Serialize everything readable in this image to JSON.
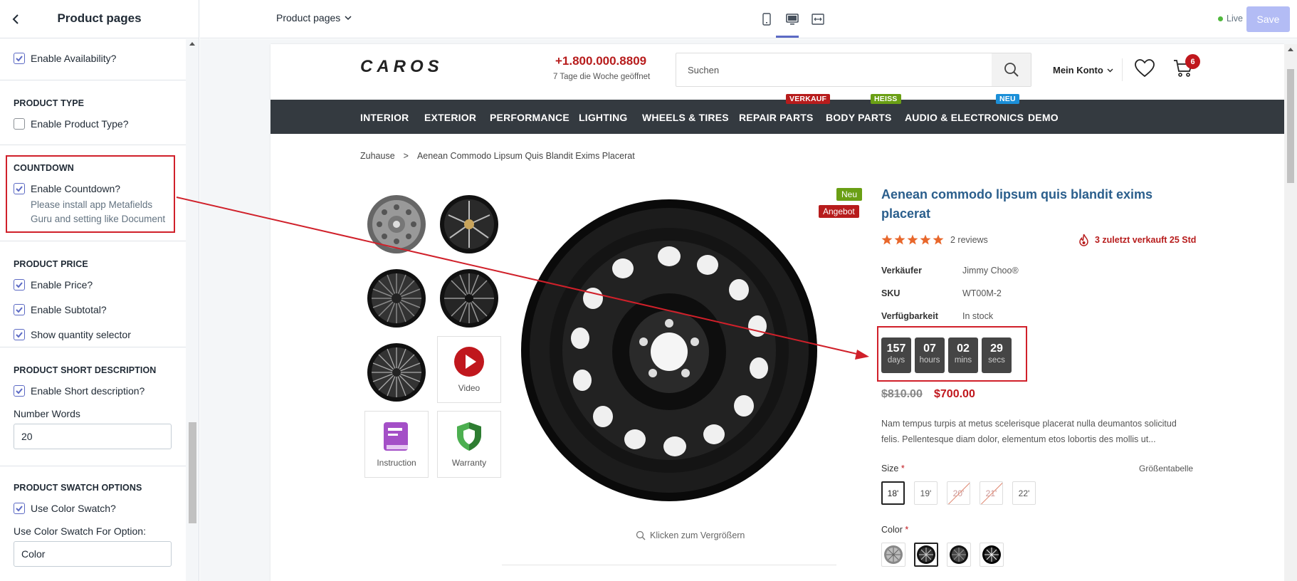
{
  "sidebar": {
    "title": "Product pages",
    "availability_label": "Enable Availability?",
    "product_type": {
      "title": "PRODUCT TYPE",
      "enable_label": "Enable Product Type?"
    },
    "countdown": {
      "title": "COUNTDOWN",
      "enable_label": "Enable Countdown?",
      "help_line1": "Please install app Metafields",
      "help_line2": "Guru and setting like Document"
    },
    "product_price": {
      "title": "PRODUCT PRICE",
      "enable_price": "Enable Price?",
      "enable_subtotal": "Enable Subtotal?",
      "show_qty": "Show quantity selector"
    },
    "short_description": {
      "title": "PRODUCT SHORT DESCRIPTION",
      "enable_label": "Enable Short description?",
      "number_words_label": "Number Words",
      "number_words_value": "20"
    },
    "swatch": {
      "title": "PRODUCT SWATCH OPTIONS",
      "use_color_swatch": "Use Color Swatch?",
      "for_option_label": "Use Color Swatch For Option:",
      "for_option_value": "Color"
    }
  },
  "topbar": {
    "page_select": "Product pages",
    "live_label": "Live",
    "save_label": "Save"
  },
  "store": {
    "logo": "CAROS",
    "phone": "+1.800.000.8809",
    "phone_sub": "7 Tage die Woche geöffnet",
    "search_placeholder": "Suchen",
    "account": "Mein Konto",
    "cart_count": "6",
    "nav": [
      {
        "label": "INTERIOR"
      },
      {
        "label": "EXTERIOR"
      },
      {
        "label": "PERFORMANCE"
      },
      {
        "label": "LIGHTING"
      },
      {
        "label": "WHEELS & TIRES"
      },
      {
        "label": "REPAIR PARTS",
        "badge": "Verkauf"
      },
      {
        "label": "BODY PARTS",
        "badge": "Heiß"
      },
      {
        "label": "AUDIO & ELECTRONICS",
        "badge": "Neu"
      },
      {
        "label": "DEMO"
      }
    ],
    "badge_colors": {
      "sale": "#b71c1c",
      "hot": "#6a9f14",
      "new": "#1b8fd8"
    }
  },
  "breadcrumb": {
    "home": "Zuhause",
    "current": "Aenean Commodo Lipsum Quis Blandit Exims Placerat"
  },
  "gallery": {
    "video_label": "Video",
    "instruction_label": "Instruction",
    "warranty_label": "Warranty",
    "badge_new": "Neu",
    "badge_sale": "Angebot",
    "zoom_label": "Klicken zum Vergrößern"
  },
  "product": {
    "title": "Aenean commodo lipsum quis blandit exims placerat",
    "rating_stars": 5,
    "reviews": "2 reviews",
    "sold": "3 zuletzt verkauft 25 Std",
    "vendor_label": "Verkäufer",
    "vendor_value": "Jimmy Choo®",
    "sku_label": "SKU",
    "sku_value": "WT00M-2",
    "availability_label": "Verfügbarkeit",
    "availability_value": "In stock",
    "countdown": [
      {
        "num": "157",
        "unit": "days"
      },
      {
        "num": "07",
        "unit": "hours"
      },
      {
        "num": "02",
        "unit": "mins"
      },
      {
        "num": "29",
        "unit": "secs"
      }
    ],
    "price_old": "$810.00",
    "price_new": "$700.00",
    "description": "Nam tempus turpis at metus scelerisque placerat nulla deumantos solicitud felis. Pellentesque diam dolor, elementum etos lobortis des mollis ut...",
    "size_label": "Size",
    "size_chart": "Größentabelle",
    "sizes": [
      "18'",
      "19'",
      "20'",
      "21'",
      "22'"
    ],
    "color_label": "Color",
    "required_mark": "*"
  },
  "colors": {
    "accent": "#5c6ac4",
    "highlight": "#d0202a",
    "navbar": "#343a40",
    "price": "#c0171d"
  }
}
